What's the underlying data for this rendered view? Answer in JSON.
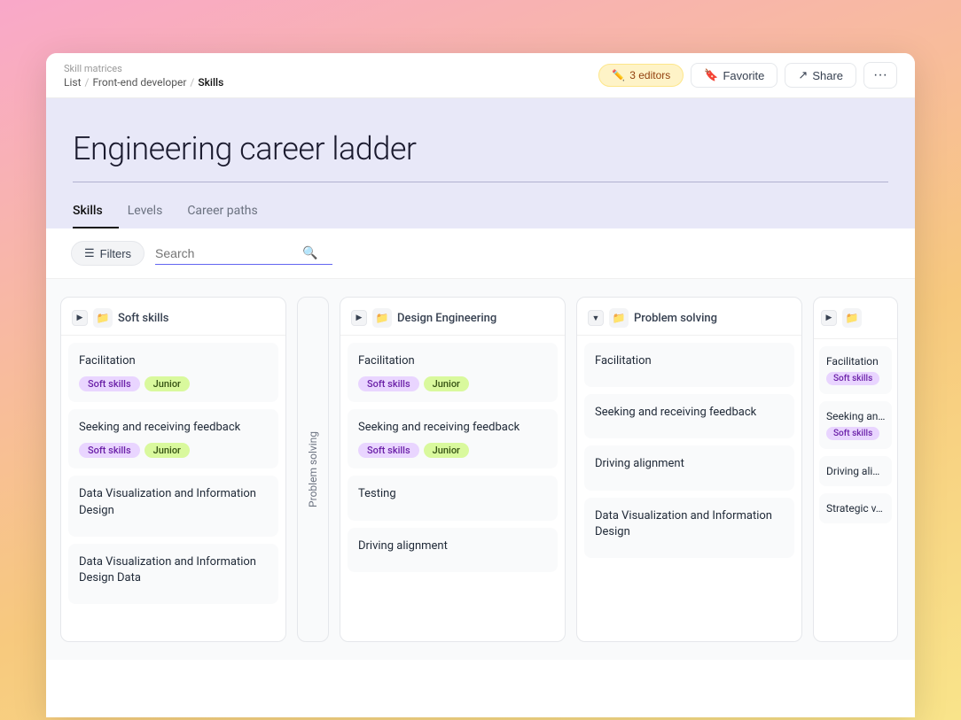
{
  "breadcrumb": {
    "title": "Skill matrices",
    "path": [
      "List",
      "Front-end developer",
      "Skills"
    ]
  },
  "topbar": {
    "editors_label": "3 editors",
    "favorite_label": "Favorite",
    "share_label": "Share",
    "more_label": "..."
  },
  "header": {
    "page_title": "Engineering career ladder"
  },
  "tabs": [
    {
      "label": "Skills",
      "active": true
    },
    {
      "label": "Levels",
      "active": false
    },
    {
      "label": "Career paths",
      "active": false
    }
  ],
  "toolbar": {
    "filters_label": "Filters",
    "search_placeholder": "Search"
  },
  "columns": [
    {
      "id": "soft-skills",
      "title": "Soft skills",
      "cards": [
        {
          "title": "Facilitation",
          "tags": [
            "Soft skills",
            "Junior"
          ]
        },
        {
          "title": "Seeking and receiving feedback",
          "tags": [
            "Soft skills",
            "Junior"
          ]
        },
        {
          "title": "Data Visualization and Information Design",
          "tags": []
        },
        {
          "title": "Data Visualization and Information Design Data",
          "tags": []
        }
      ]
    },
    {
      "id": "problem-solving-rotated",
      "rotated": true,
      "rotated_label": "Problem solving"
    },
    {
      "id": "design-engineering",
      "title": "Design Engineering",
      "cards": [
        {
          "title": "Facilitation",
          "tags": [
            "Soft skills",
            "Junior"
          ]
        },
        {
          "title": "Seeking and receiving feedback",
          "tags": [
            "Soft skills",
            "Junior"
          ]
        },
        {
          "title": "Testing",
          "tags": []
        },
        {
          "title": "Driving alignment",
          "tags": []
        }
      ]
    },
    {
      "id": "problem-solving",
      "title": "Problem solving",
      "cards": [
        {
          "title": "Facilitation",
          "tags": []
        },
        {
          "title": "Seeking and receiving feedback",
          "tags": []
        },
        {
          "title": "Driving alignment",
          "tags": []
        },
        {
          "title": "Data Visualization and Information Design",
          "tags": []
        }
      ]
    },
    {
      "id": "partial",
      "title": "…",
      "cards": [
        {
          "title": "Facilitation",
          "tags": [
            "Soft skills"
          ]
        },
        {
          "title": "Seeking and…",
          "tags": [
            "Soft skills"
          ]
        },
        {
          "title": "Driving ali…",
          "tags": []
        },
        {
          "title": "Strategic v…",
          "tags": []
        }
      ]
    }
  ]
}
